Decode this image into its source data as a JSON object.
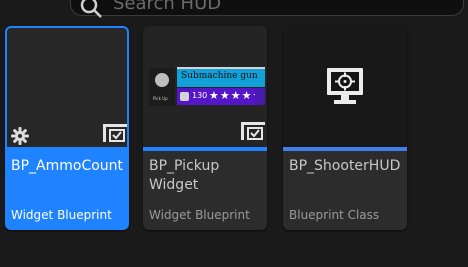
{
  "search": {
    "placeholder": "Search HUD"
  },
  "assets": [
    {
      "name": "BP_AmmoCount",
      "type": "Widget Blueprint",
      "selected": true
    },
    {
      "name": "BP_Pickup Widget",
      "type": "Widget Blueprint",
      "selected": false,
      "preview": {
        "title": "Submachine gun",
        "label": "Pick Up",
        "rating_number": "130",
        "stars": "★★★★★"
      }
    },
    {
      "name": "BP_ShooterHUD",
      "type": "Blueprint Class",
      "selected": false
    }
  ],
  "colors": {
    "selection": "#1f83ff",
    "widget_blueprint_bar": "#1f83ff",
    "blueprint_class_bar": "#3f7fe6",
    "preview_title_bg": "#12a0d8",
    "preview_rating_bg": "#5516c8"
  },
  "icons": {
    "filter": "filter-icon",
    "search": "search-icon",
    "widget_badge": "widget-badge-icon",
    "gear": "gear-icon",
    "hud_monitor": "monitor-crosshair-icon"
  }
}
